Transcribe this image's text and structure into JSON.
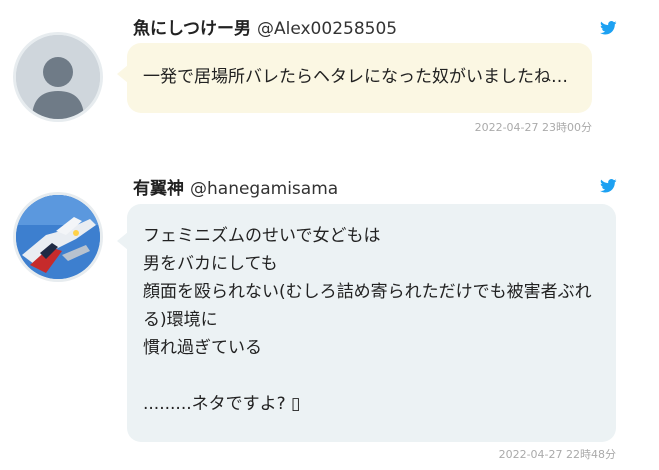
{
  "tweets": [
    {
      "display_name": "魚にしつけー男",
      "handle": "@Alex00258505",
      "avatar": "default-avatar",
      "lines": [
        "一発で居場所バレたらヘタレになった奴がいましたね…"
      ],
      "timestamp": "2022-04-27 23時00分"
    },
    {
      "display_name": "有翼神",
      "handle": "@hanegamisama",
      "avatar": "robot-avatar",
      "lines": [
        "フェミニズムのせいで女どもは",
        "男をバカにしても",
        "顔面を殴られない(むしろ詰め寄られただけでも被害者ぶれ",
        "る)環境に",
        "慣れ過ぎている",
        "",
        ".........ネタですよ? ▯"
      ],
      "timestamp": "2022-04-27 22時48分"
    }
  ],
  "colors": {
    "twitter_blue": "#1da1f2",
    "bubble_1": "#fbf7e3",
    "bubble_2": "#ecf2f4",
    "timestamp": "#aaaaaa"
  }
}
